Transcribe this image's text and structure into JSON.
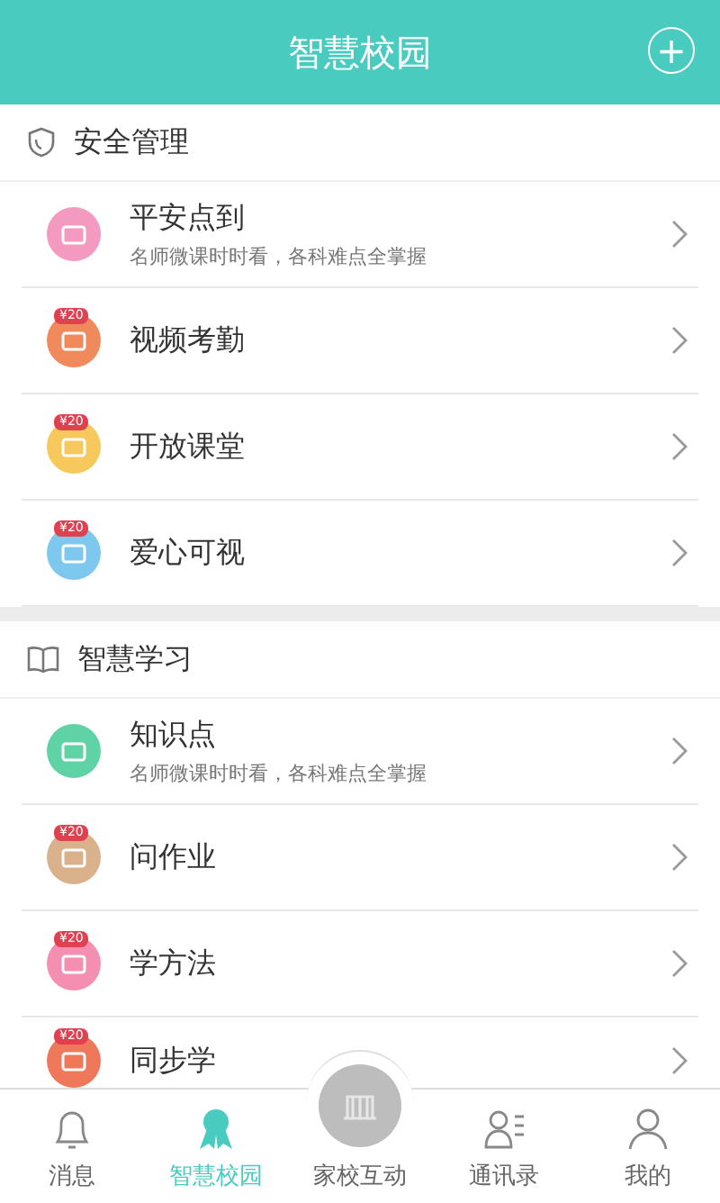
{
  "header": {
    "title": "智慧校园",
    "action": "+"
  },
  "sections": [
    {
      "title": "安全管理",
      "items": [
        {
          "title": "平安点到",
          "subtitle": "名师微课时时看，各科难点全掌握",
          "color": "#f49ac1"
        },
        {
          "title": "视频考勤",
          "badge": "¥20",
          "color": "#f08a5d"
        },
        {
          "title": "开放课堂",
          "badge": "¥20",
          "color": "#f7c95c"
        },
        {
          "title": "爱心可视",
          "badge": "¥20",
          "color": "#7ec8f0"
        }
      ]
    },
    {
      "title": "智慧学习",
      "items": [
        {
          "title": "知识点",
          "subtitle": "名师微课时时看，各科难点全掌握",
          "color": "#5fd3a5"
        },
        {
          "title": "问作业",
          "badge": "¥20",
          "color": "#d9b28c"
        },
        {
          "title": "学方法",
          "badge": "¥20",
          "color": "#f48fb1"
        },
        {
          "title": "同步学",
          "badge": "¥20",
          "color": "#f0785a"
        }
      ]
    }
  ],
  "tabs": [
    {
      "label": "消息",
      "selected": false
    },
    {
      "label": "智慧校园",
      "selected": true
    },
    {
      "label": "家校互动",
      "selected": false
    },
    {
      "label": "通讯录",
      "selected": false
    },
    {
      "label": "我的",
      "selected": false
    }
  ]
}
